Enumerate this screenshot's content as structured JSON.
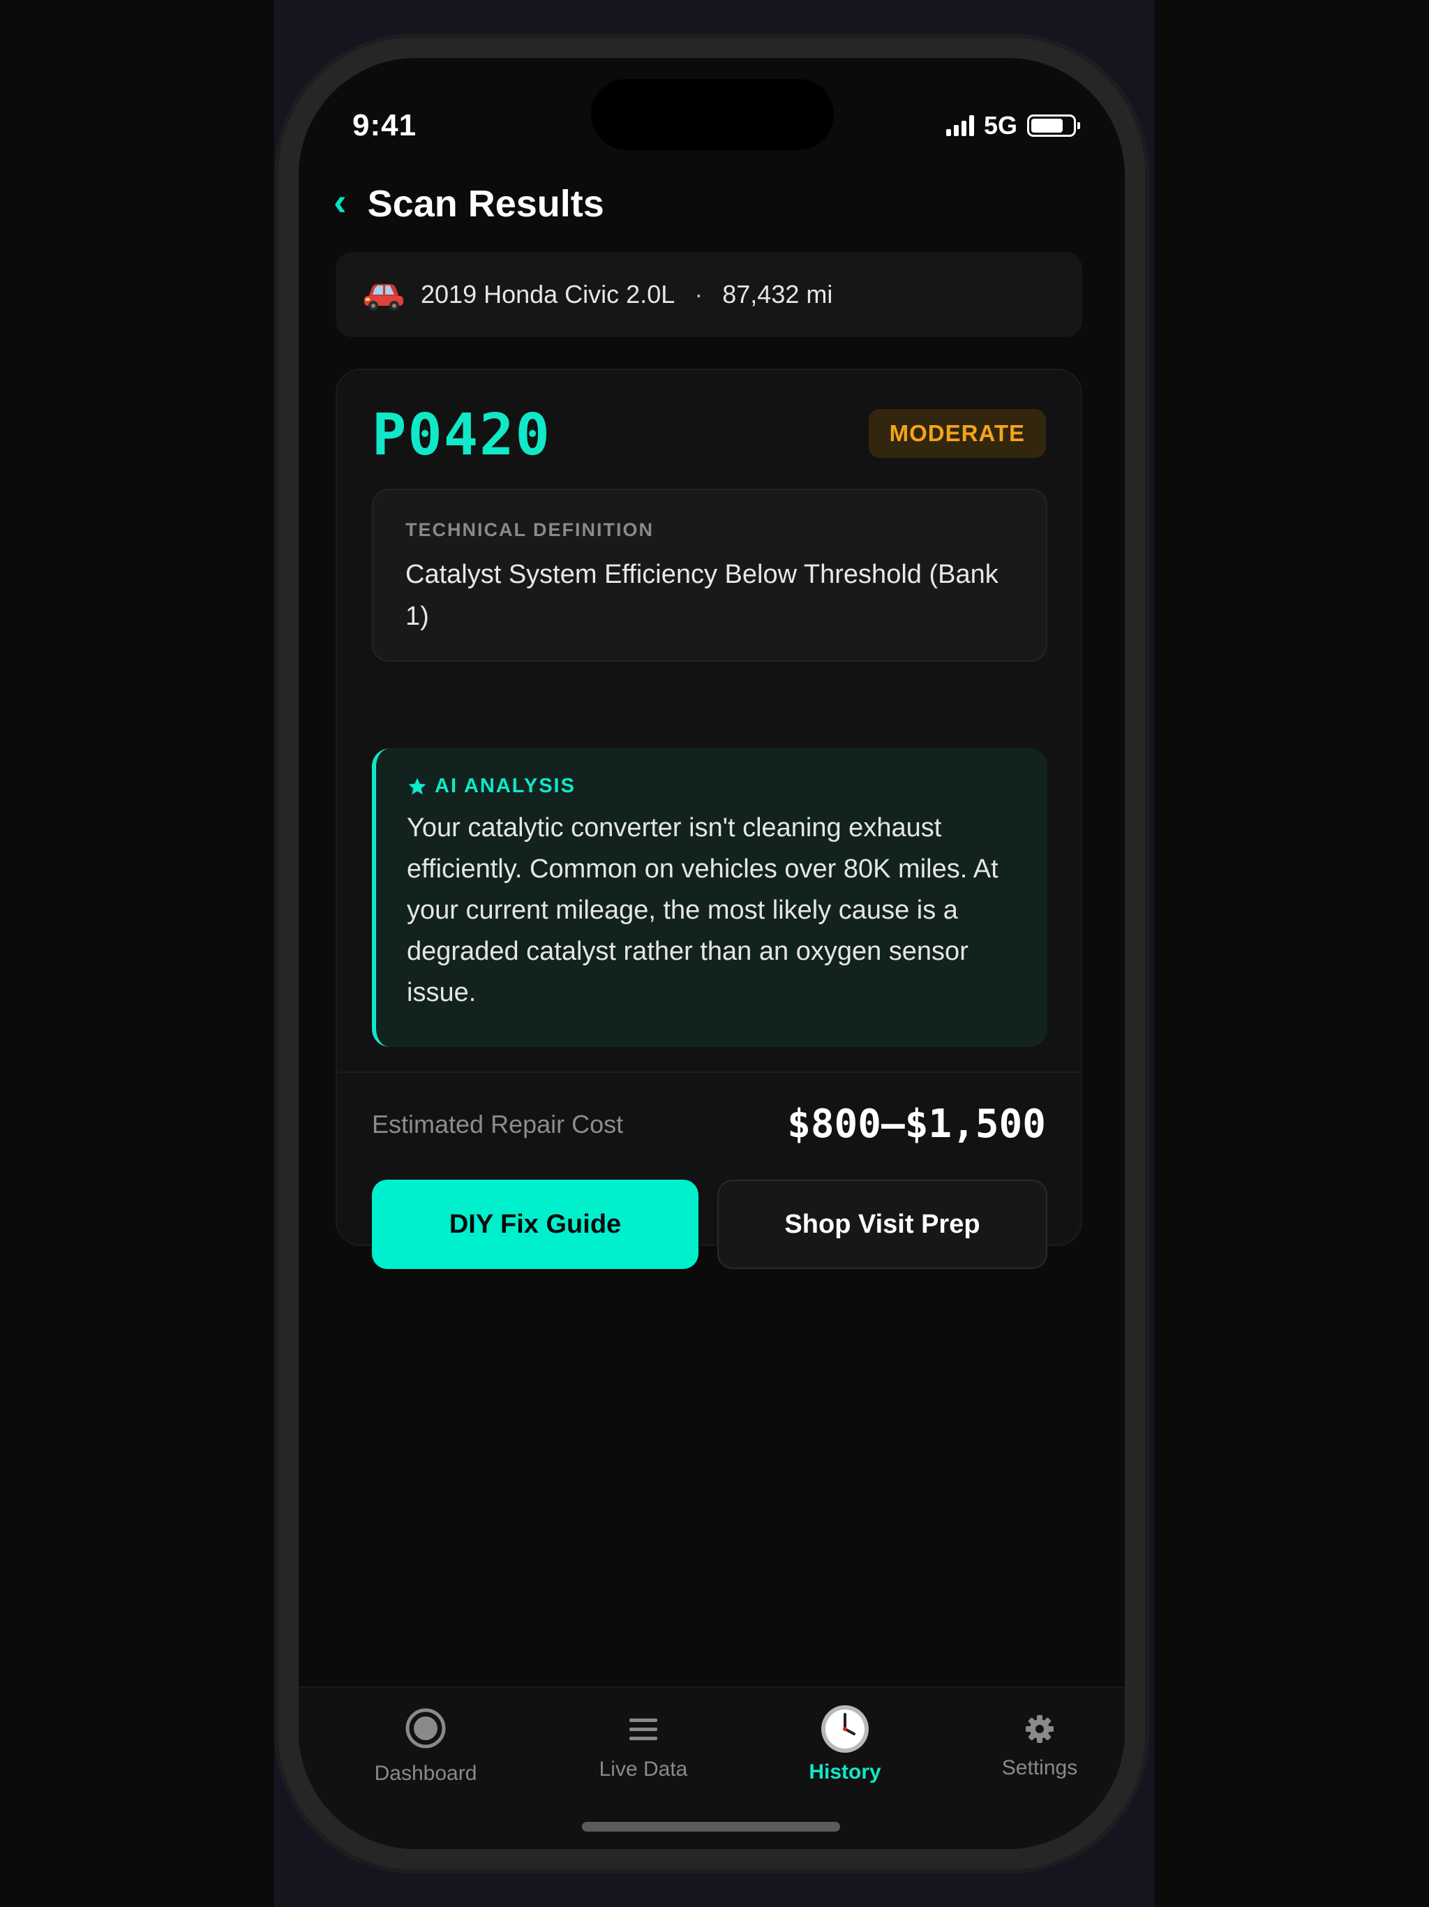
{
  "status_bar": {
    "time": "9:41",
    "network": "5G"
  },
  "header": {
    "back_symbol": "‹",
    "title": "Scan Results"
  },
  "vehicle": {
    "icon": "car-icon",
    "name": "2019 Honda Civic 2.0L",
    "separator": "·",
    "mileage": "87,432 mi"
  },
  "result": {
    "code": "P0420",
    "severity": "MODERATE",
    "definition_label": "TECHNICAL DEFINITION",
    "definition": "Catalyst System Efficiency Below Threshold (Bank 1)",
    "ai_label": "AI ANALYSIS",
    "ai_text": "Your catalytic converter isn't cleaning exhaust efficiently. Common on vehicles over 80K miles. At your current mileage, the most likely cause is a degraded catalyst rather than an oxygen sensor issue.",
    "cost_label": "Estimated Repair Cost",
    "cost_value": "$800–$1,500",
    "primary_action": "DIY Fix Guide",
    "secondary_action": "Shop Visit Prep"
  },
  "tabs": [
    {
      "label": "Dashboard",
      "icon": "dashboard-icon",
      "active": false
    },
    {
      "label": "Live Data",
      "icon": "list-icon",
      "active": false
    },
    {
      "label": "History",
      "icon": "clock-icon",
      "active": true
    },
    {
      "label": "Settings",
      "icon": "gear-icon",
      "active": false
    }
  ],
  "colors": {
    "accent": "#10e8c8",
    "button_primary": "#00efcd",
    "severity_text": "#f2a519",
    "severity_bg": "#33260f",
    "background": "#0b0b0b",
    "card": "#121212",
    "ai_box": "#12231f"
  }
}
